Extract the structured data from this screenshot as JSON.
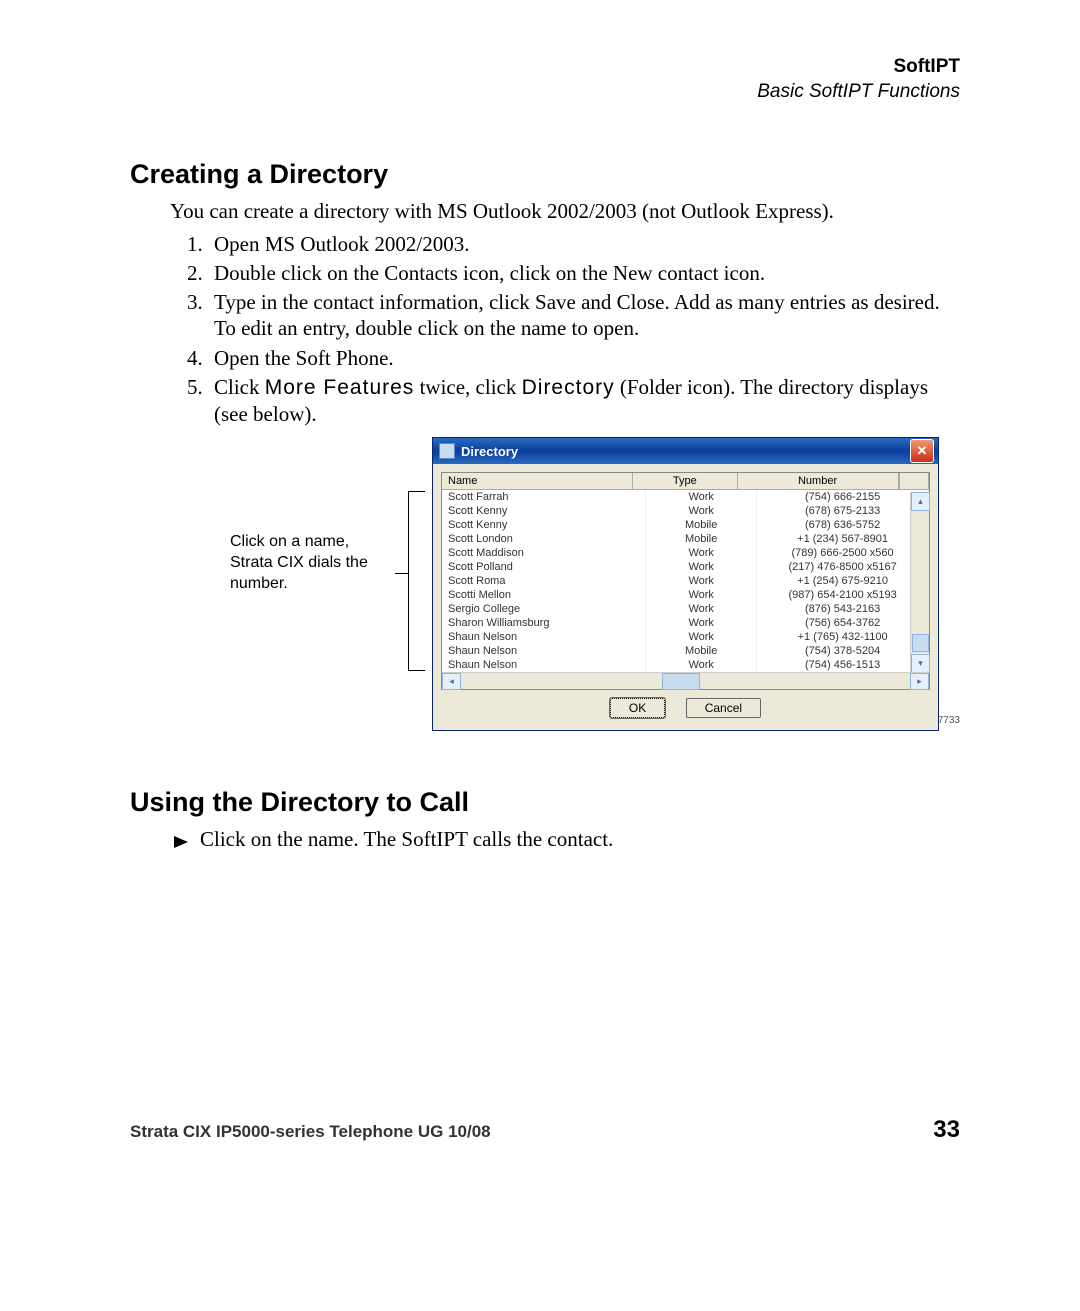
{
  "header": {
    "title": "SoftIPT",
    "subtitle": "Basic SoftIPT Functions"
  },
  "h1": "Creating a Directory",
  "intro": "You can create a directory with MS Outlook 2002/2003 (not Outlook Express).",
  "steps": [
    "Open MS Outlook 2002/2003.",
    "Double click on the Contacts icon, click on the New contact icon.",
    "Type in the contact information, click Save and Close. Add as many entries as desired. To edit an entry, double click on the name to open.",
    "Open the Soft Phone."
  ],
  "step5_a": "Click ",
  "step5_mf": "More Features",
  "step5_b": " twice, click ",
  "step5_dir": "Directory",
  "step5_c": " (Folder icon). The directory displays (see below).",
  "caption": "Click on a name, Strata CIX dials the number.",
  "dialog": {
    "title": "Directory",
    "cols": {
      "name": "Name",
      "type": "Type",
      "number": "Number"
    },
    "rows": [
      {
        "name": "Scott Farrah",
        "type": "Work",
        "number": "(754) 666-2155"
      },
      {
        "name": "Scott Kenny",
        "type": "Work",
        "number": "(678) 675-2133"
      },
      {
        "name": "Scott Kenny",
        "type": "Mobile",
        "number": "(678) 636-5752"
      },
      {
        "name": "Scott London",
        "type": "Mobile",
        "number": "+1 (234) 567-8901"
      },
      {
        "name": "Scott Maddison",
        "type": "Work",
        "number": "(789) 666-2500 x560"
      },
      {
        "name": "Scott Polland",
        "type": "Work",
        "number": "(217) 476-8500 x5167"
      },
      {
        "name": "Scott Roma",
        "type": "Work",
        "number": "+1 (254) 675-9210"
      },
      {
        "name": "Scotti Mellon",
        "type": "Work",
        "number": "(987) 654-2100 x5193"
      },
      {
        "name": "Sergio College",
        "type": "Work",
        "number": "(876) 543-2163"
      },
      {
        "name": "Sharon Williamsburg",
        "type": "Work",
        "number": "(756) 654-3762"
      },
      {
        "name": "Shaun Nelson",
        "type": "Work",
        "number": "+1 (765) 432-1100"
      },
      {
        "name": "Shaun Nelson",
        "type": "Mobile",
        "number": "(754) 378-5204"
      },
      {
        "name": "Shaun Nelson",
        "type": "Work",
        "number": "(754) 456-1513"
      }
    ],
    "ok": "OK",
    "cancel": "Cancel",
    "figno": "7733"
  },
  "h2": "Using the Directory to Call",
  "bullet": "Click on the name. The SoftIPT calls the contact.",
  "footer": {
    "left": "Strata CIX IP5000-series Telephone UG    10/08",
    "right": "33"
  }
}
